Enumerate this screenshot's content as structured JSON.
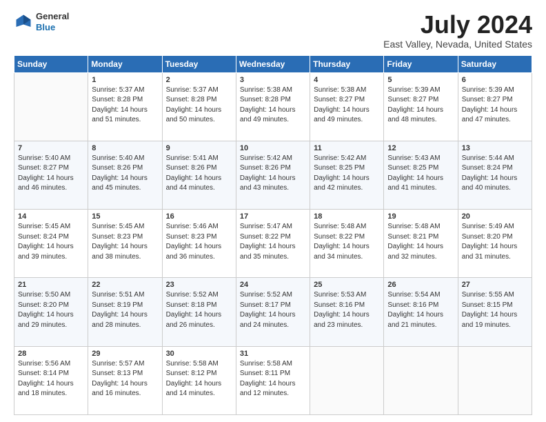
{
  "header": {
    "logo_line1": "General",
    "logo_line2": "Blue",
    "title": "July 2024",
    "subtitle": "East Valley, Nevada, United States"
  },
  "columns": [
    "Sunday",
    "Monday",
    "Tuesday",
    "Wednesday",
    "Thursday",
    "Friday",
    "Saturday"
  ],
  "weeks": [
    [
      {
        "day": "",
        "info": ""
      },
      {
        "day": "1",
        "info": "Sunrise: 5:37 AM\nSunset: 8:28 PM\nDaylight: 14 hours\nand 51 minutes."
      },
      {
        "day": "2",
        "info": "Sunrise: 5:37 AM\nSunset: 8:28 PM\nDaylight: 14 hours\nand 50 minutes."
      },
      {
        "day": "3",
        "info": "Sunrise: 5:38 AM\nSunset: 8:28 PM\nDaylight: 14 hours\nand 49 minutes."
      },
      {
        "day": "4",
        "info": "Sunrise: 5:38 AM\nSunset: 8:27 PM\nDaylight: 14 hours\nand 49 minutes."
      },
      {
        "day": "5",
        "info": "Sunrise: 5:39 AM\nSunset: 8:27 PM\nDaylight: 14 hours\nand 48 minutes."
      },
      {
        "day": "6",
        "info": "Sunrise: 5:39 AM\nSunset: 8:27 PM\nDaylight: 14 hours\nand 47 minutes."
      }
    ],
    [
      {
        "day": "7",
        "info": "Sunrise: 5:40 AM\nSunset: 8:27 PM\nDaylight: 14 hours\nand 46 minutes."
      },
      {
        "day": "8",
        "info": "Sunrise: 5:40 AM\nSunset: 8:26 PM\nDaylight: 14 hours\nand 45 minutes."
      },
      {
        "day": "9",
        "info": "Sunrise: 5:41 AM\nSunset: 8:26 PM\nDaylight: 14 hours\nand 44 minutes."
      },
      {
        "day": "10",
        "info": "Sunrise: 5:42 AM\nSunset: 8:26 PM\nDaylight: 14 hours\nand 43 minutes."
      },
      {
        "day": "11",
        "info": "Sunrise: 5:42 AM\nSunset: 8:25 PM\nDaylight: 14 hours\nand 42 minutes."
      },
      {
        "day": "12",
        "info": "Sunrise: 5:43 AM\nSunset: 8:25 PM\nDaylight: 14 hours\nand 41 minutes."
      },
      {
        "day": "13",
        "info": "Sunrise: 5:44 AM\nSunset: 8:24 PM\nDaylight: 14 hours\nand 40 minutes."
      }
    ],
    [
      {
        "day": "14",
        "info": "Sunrise: 5:45 AM\nSunset: 8:24 PM\nDaylight: 14 hours\nand 39 minutes."
      },
      {
        "day": "15",
        "info": "Sunrise: 5:45 AM\nSunset: 8:23 PM\nDaylight: 14 hours\nand 38 minutes."
      },
      {
        "day": "16",
        "info": "Sunrise: 5:46 AM\nSunset: 8:23 PM\nDaylight: 14 hours\nand 36 minutes."
      },
      {
        "day": "17",
        "info": "Sunrise: 5:47 AM\nSunset: 8:22 PM\nDaylight: 14 hours\nand 35 minutes."
      },
      {
        "day": "18",
        "info": "Sunrise: 5:48 AM\nSunset: 8:22 PM\nDaylight: 14 hours\nand 34 minutes."
      },
      {
        "day": "19",
        "info": "Sunrise: 5:48 AM\nSunset: 8:21 PM\nDaylight: 14 hours\nand 32 minutes."
      },
      {
        "day": "20",
        "info": "Sunrise: 5:49 AM\nSunset: 8:20 PM\nDaylight: 14 hours\nand 31 minutes."
      }
    ],
    [
      {
        "day": "21",
        "info": "Sunrise: 5:50 AM\nSunset: 8:20 PM\nDaylight: 14 hours\nand 29 minutes."
      },
      {
        "day": "22",
        "info": "Sunrise: 5:51 AM\nSunset: 8:19 PM\nDaylight: 14 hours\nand 28 minutes."
      },
      {
        "day": "23",
        "info": "Sunrise: 5:52 AM\nSunset: 8:18 PM\nDaylight: 14 hours\nand 26 minutes."
      },
      {
        "day": "24",
        "info": "Sunrise: 5:52 AM\nSunset: 8:17 PM\nDaylight: 14 hours\nand 24 minutes."
      },
      {
        "day": "25",
        "info": "Sunrise: 5:53 AM\nSunset: 8:16 PM\nDaylight: 14 hours\nand 23 minutes."
      },
      {
        "day": "26",
        "info": "Sunrise: 5:54 AM\nSunset: 8:16 PM\nDaylight: 14 hours\nand 21 minutes."
      },
      {
        "day": "27",
        "info": "Sunrise: 5:55 AM\nSunset: 8:15 PM\nDaylight: 14 hours\nand 19 minutes."
      }
    ],
    [
      {
        "day": "28",
        "info": "Sunrise: 5:56 AM\nSunset: 8:14 PM\nDaylight: 14 hours\nand 18 minutes."
      },
      {
        "day": "29",
        "info": "Sunrise: 5:57 AM\nSunset: 8:13 PM\nDaylight: 14 hours\nand 16 minutes."
      },
      {
        "day": "30",
        "info": "Sunrise: 5:58 AM\nSunset: 8:12 PM\nDaylight: 14 hours\nand 14 minutes."
      },
      {
        "day": "31",
        "info": "Sunrise: 5:58 AM\nSunset: 8:11 PM\nDaylight: 14 hours\nand 12 minutes."
      },
      {
        "day": "",
        "info": ""
      },
      {
        "day": "",
        "info": ""
      },
      {
        "day": "",
        "info": ""
      }
    ]
  ]
}
